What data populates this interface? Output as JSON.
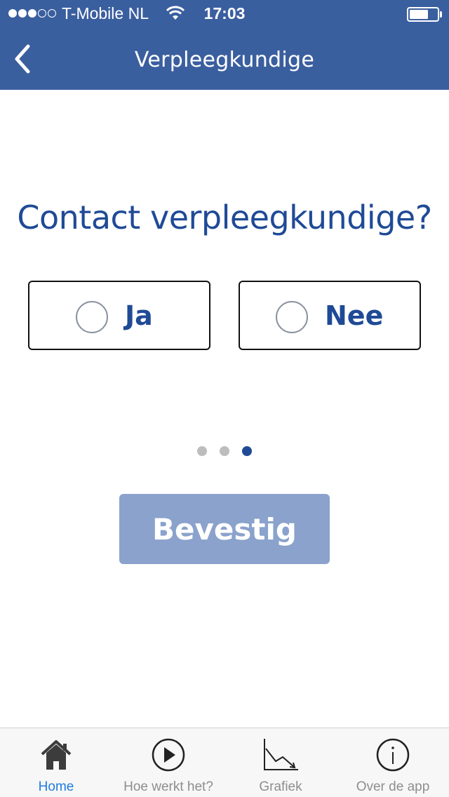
{
  "status_bar": {
    "carrier": "T-Mobile NL",
    "time": "17:03",
    "signal_bars_filled": 3,
    "signal_bars_total": 5
  },
  "nav": {
    "title": "Verpleegkundige"
  },
  "question": {
    "text": "Contact verpleegkundige?"
  },
  "options": [
    {
      "label": "Ja",
      "selected": false
    },
    {
      "label": "Nee",
      "selected": false
    }
  ],
  "pager": {
    "total": 3,
    "current": 3
  },
  "confirm": {
    "label": "Bevestig"
  },
  "tabbar": {
    "tabs": [
      {
        "label": "Home",
        "icon": "home-icon",
        "active": true
      },
      {
        "label": "Hoe werkt het?",
        "icon": "play-icon",
        "active": false
      },
      {
        "label": "Grafiek",
        "icon": "chart-icon",
        "active": false
      },
      {
        "label": "Over de app",
        "icon": "info-icon",
        "active": false
      }
    ]
  },
  "colors": {
    "header": "#3a5f9f",
    "primary_text": "#1f4a96",
    "confirm_disabled": "#8aa2cc",
    "tab_active": "#1f7ce0",
    "tab_inactive": "#8e8e8e"
  }
}
